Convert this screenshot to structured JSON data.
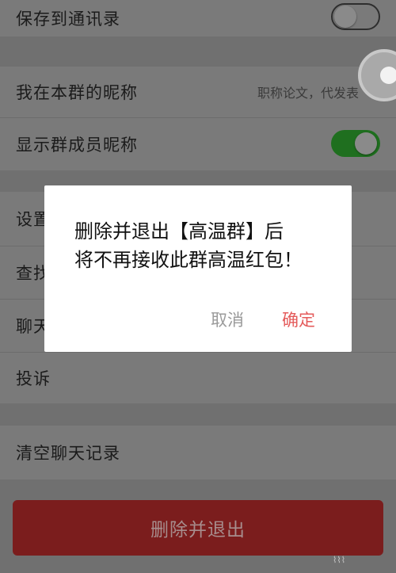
{
  "settings": {
    "rows": [
      {
        "label": "保存到通讯录"
      },
      {
        "label": "我在本群的昵称",
        "value": "职称论文，代发表"
      },
      {
        "label": "显示群成员昵称"
      },
      {
        "label": "设置"
      },
      {
        "label": "查找"
      },
      {
        "label": "聊天"
      },
      {
        "label": "投诉"
      },
      {
        "label": "清空聊天记录"
      }
    ],
    "toggles": {
      "save_to_contacts": "off",
      "show_member_nicknames": "on"
    },
    "delete_exit_label": "删除并退出"
  },
  "dialog": {
    "line1": "删除并退出【高温群】后",
    "line2": "将不再接收此群高温红包！",
    "cancel_label": "取消",
    "confirm_label": "确定"
  },
  "colors": {
    "toggle_on": "#1f6f1f",
    "danger": "#7b1d1d",
    "confirm_text": "#e45b5b"
  }
}
